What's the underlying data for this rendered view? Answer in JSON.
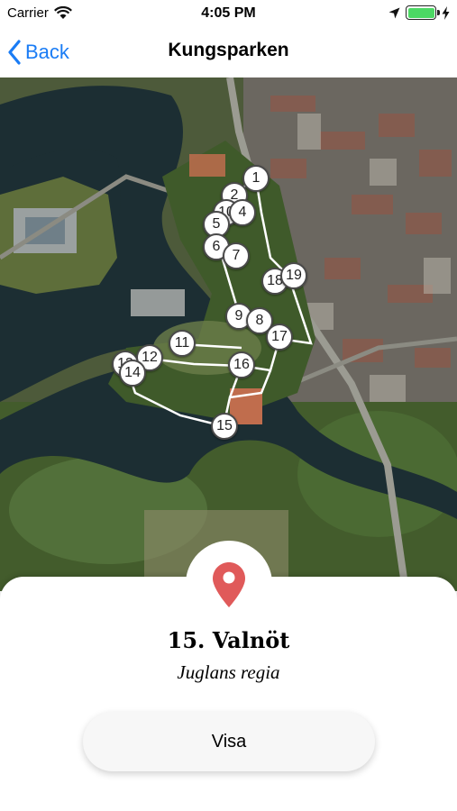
{
  "status_bar": {
    "carrier": "Carrier",
    "time": "4:05 PM",
    "battery_level": 1.0,
    "icons": [
      "wifi-icon",
      "location-arrow-icon",
      "battery-icon",
      "charging-bolt-icon"
    ]
  },
  "nav": {
    "back_label": "Back",
    "title": "Kungsparken"
  },
  "map": {
    "route_color": "#ffffff",
    "markers": [
      {
        "label": "1"
      },
      {
        "label": "2"
      },
      {
        "label": "10"
      },
      {
        "label": "4"
      },
      {
        "label": "5"
      },
      {
        "label": "6"
      },
      {
        "label": "7"
      },
      {
        "label": "18"
      },
      {
        "label": "19"
      },
      {
        "label": "9"
      },
      {
        "label": "8"
      },
      {
        "label": "17"
      },
      {
        "label": "11"
      },
      {
        "label": "12"
      },
      {
        "label": "13"
      },
      {
        "label": "14"
      },
      {
        "label": "16"
      },
      {
        "label": "15"
      }
    ]
  },
  "card": {
    "pin_icon": "map-pin-icon",
    "pin_color": "#e05a5a",
    "title": "15. Valnöt",
    "subtitle": "Juglans regia",
    "button_label": "Visa"
  },
  "colors": {
    "accent": "#1a7cf5",
    "battery": "#4cd964"
  }
}
